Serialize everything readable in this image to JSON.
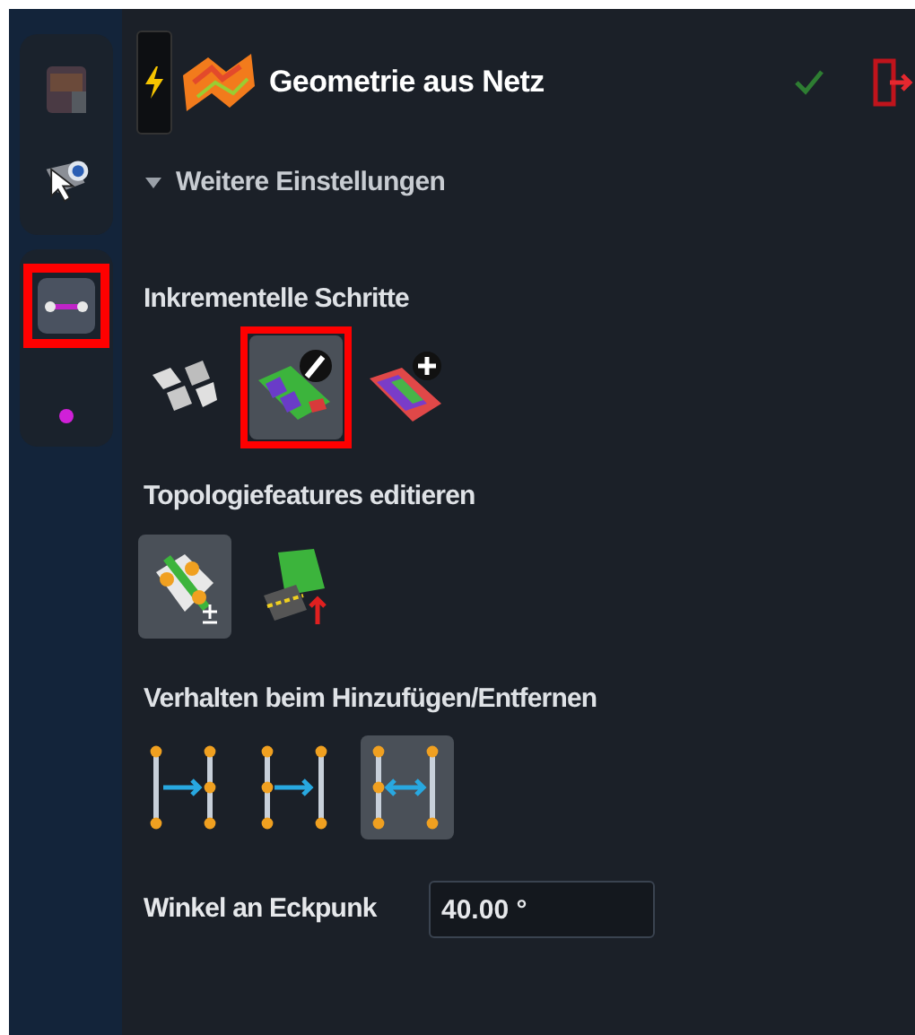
{
  "rail": [
    {
      "kind": "texture",
      "selected": false,
      "highlighted": false
    },
    {
      "kind": "pointer-eye",
      "selected": false,
      "highlighted": false
    },
    {
      "kind": "line",
      "selected": true,
      "highlighted": true
    },
    {
      "kind": "dot",
      "selected": false,
      "highlighted": false
    }
  ],
  "header": {
    "title": "Geometrie aus Netz"
  },
  "settings": {
    "label": "Weitere Einstellungen",
    "expanded": true
  },
  "sections": [
    {
      "title": "Inkrementelle Schritte",
      "tools": [
        {
          "kind": "tiles",
          "selected": false,
          "highlighted": false
        },
        {
          "kind": "edit-strip",
          "selected": true,
          "highlighted": true
        },
        {
          "kind": "add-strip",
          "selected": false,
          "highlighted": false
        }
      ]
    },
    {
      "title": "Topologiefeatures editieren",
      "tools": [
        {
          "kind": "topo-nodes",
          "selected": true,
          "highlighted": false
        },
        {
          "kind": "topo-up",
          "selected": false,
          "highlighted": false
        }
      ]
    },
    {
      "title": "Verhalten beim Hinzufügen/Entfernen",
      "tools": [
        {
          "kind": "move-right",
          "selected": false,
          "highlighted": false
        },
        {
          "kind": "move-right-2",
          "selected": false,
          "highlighted": false
        },
        {
          "kind": "move-both",
          "selected": true,
          "highlighted": false
        }
      ]
    }
  ],
  "angle": {
    "label": "Winkel an Eckpunk",
    "value": "40.00 °"
  }
}
